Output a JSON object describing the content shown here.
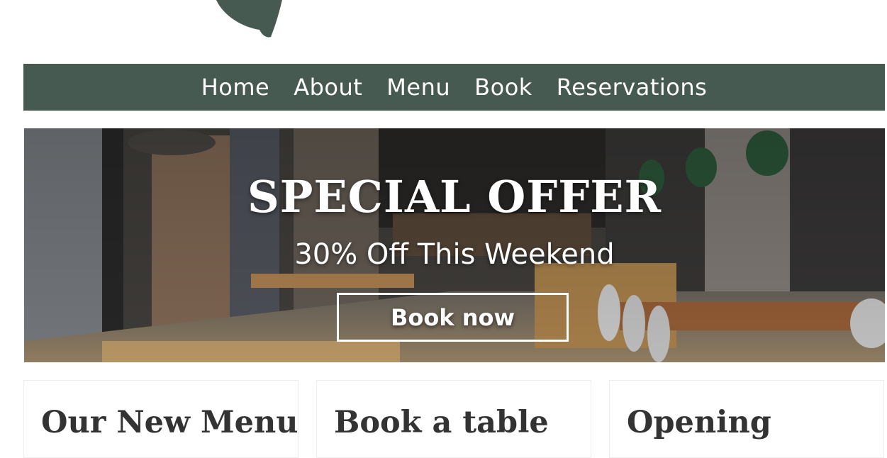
{
  "brand": {
    "logo_icon": "leaf-icon",
    "logo_color": "#475a52"
  },
  "nav": {
    "background": "#475a52",
    "items": [
      {
        "label": "Home"
      },
      {
        "label": "About"
      },
      {
        "label": "Menu"
      },
      {
        "label": "Book"
      },
      {
        "label": "Reservations"
      }
    ]
  },
  "hero": {
    "background_image": "restaurant-interior-photo",
    "title": "SPECIAL OFFER",
    "subtitle": "30% Off This Weekend",
    "button_label": "Book now"
  },
  "cards": [
    {
      "title": "Our New Menu"
    },
    {
      "title": "Book a table"
    },
    {
      "title": "Opening"
    }
  ]
}
